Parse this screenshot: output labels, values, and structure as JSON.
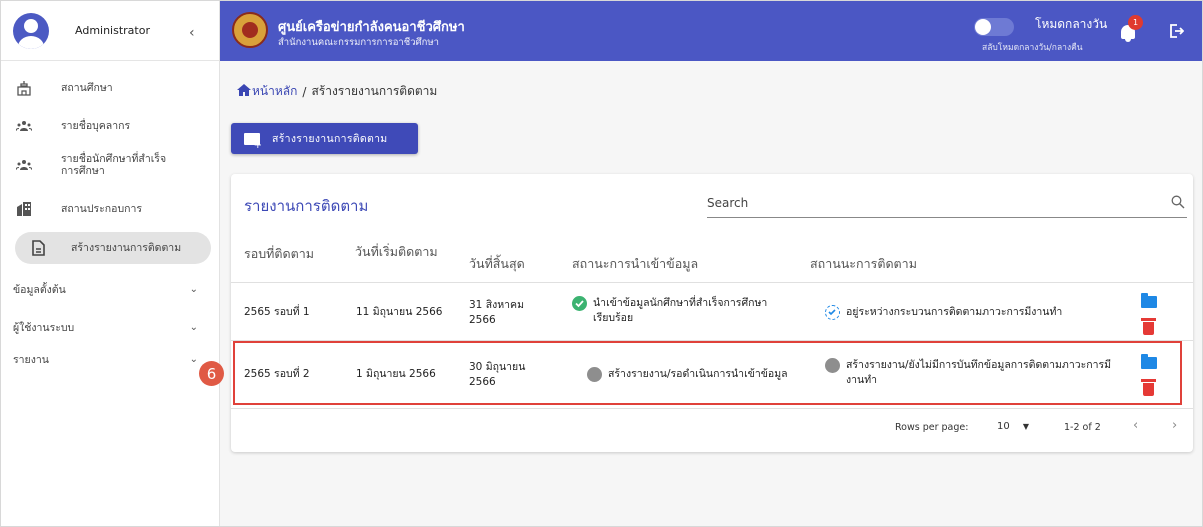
{
  "sidebar": {
    "user_name": "Administrator",
    "items": [
      {
        "label": "สถานศึกษา",
        "icon": "school-icon"
      },
      {
        "label": "รายชื่อบุคลากร",
        "icon": "people-icon"
      },
      {
        "label": "รายชื่อนักศึกษาที่สำเร็จ การศึกษา",
        "icon": "graduates-icon"
      },
      {
        "label": "สถานประกอบการ",
        "icon": "building-icon"
      },
      {
        "label": "สร้างรายงานการติดตาม",
        "icon": "document-icon"
      }
    ],
    "groups": [
      {
        "label": "ข้อมูลตั้งต้น"
      },
      {
        "label": "ผู้ใช้งานระบบ"
      },
      {
        "label": "รายงาน"
      }
    ]
  },
  "header": {
    "title": "ศูนย์เครือข่ายกำลังคนอาชีวศึกษา",
    "subtitle": "สำนักงานคณะกรรมการการอาชีวศึกษา",
    "mode_label": "โหมดกลางวัน",
    "mode_sub": "สลับโหมดกลางวัน/กลางคืน",
    "notification_count": "1"
  },
  "breadcrumb": {
    "home": "หน้าหลัก",
    "separator": "/",
    "current": "สร้างรายงานการติดตาม"
  },
  "create_button": "สร้างรายงานการติดตาม",
  "table": {
    "title": "รายงานการติดตาม",
    "search_placeholder": "Search",
    "headers": [
      "รอบที่ติดตาม",
      "วันที่เริ่มติดตาม",
      "วันที่สิ้นสุด",
      "สถานะการนำเข้าข้อมูล",
      "สถานนะการติดตาม"
    ],
    "rows": [
      {
        "round": "2565 รอบที่ 1",
        "start": "11 มิถุนายน 2566",
        "end": "31 สิงหาคม 2566",
        "import_status": "นำเข้าข้อมูลนักศึกษาที่สำเร็จการศึกษาเรียบร้อย",
        "track_status": "อยู่ระหว่างกระบวนการติดตามภาวะการมีงานทำ"
      },
      {
        "round": "2565 รอบที่ 2",
        "start": "1 มิถุนายน 2566",
        "end": "30 มิถุนายน 2566",
        "import_status": "สร้างรายงาน/รอดำเนินการนำเข้าข้อมูล",
        "track_status": "สร้างรายงาน/ยังไม่มีการบันทึกข้อมูลการติดตามภาวะการมีงานทำ"
      }
    ],
    "rows_per_page_label": "Rows per page:",
    "rows_per_page": "10",
    "range": "1-2 of 2"
  },
  "annotation_step": "6",
  "colors": {
    "primary": "#4b57c4",
    "highlight": "#e0413a",
    "success": "#3cb371",
    "info": "#1e88e5",
    "danger": "#e53935"
  }
}
